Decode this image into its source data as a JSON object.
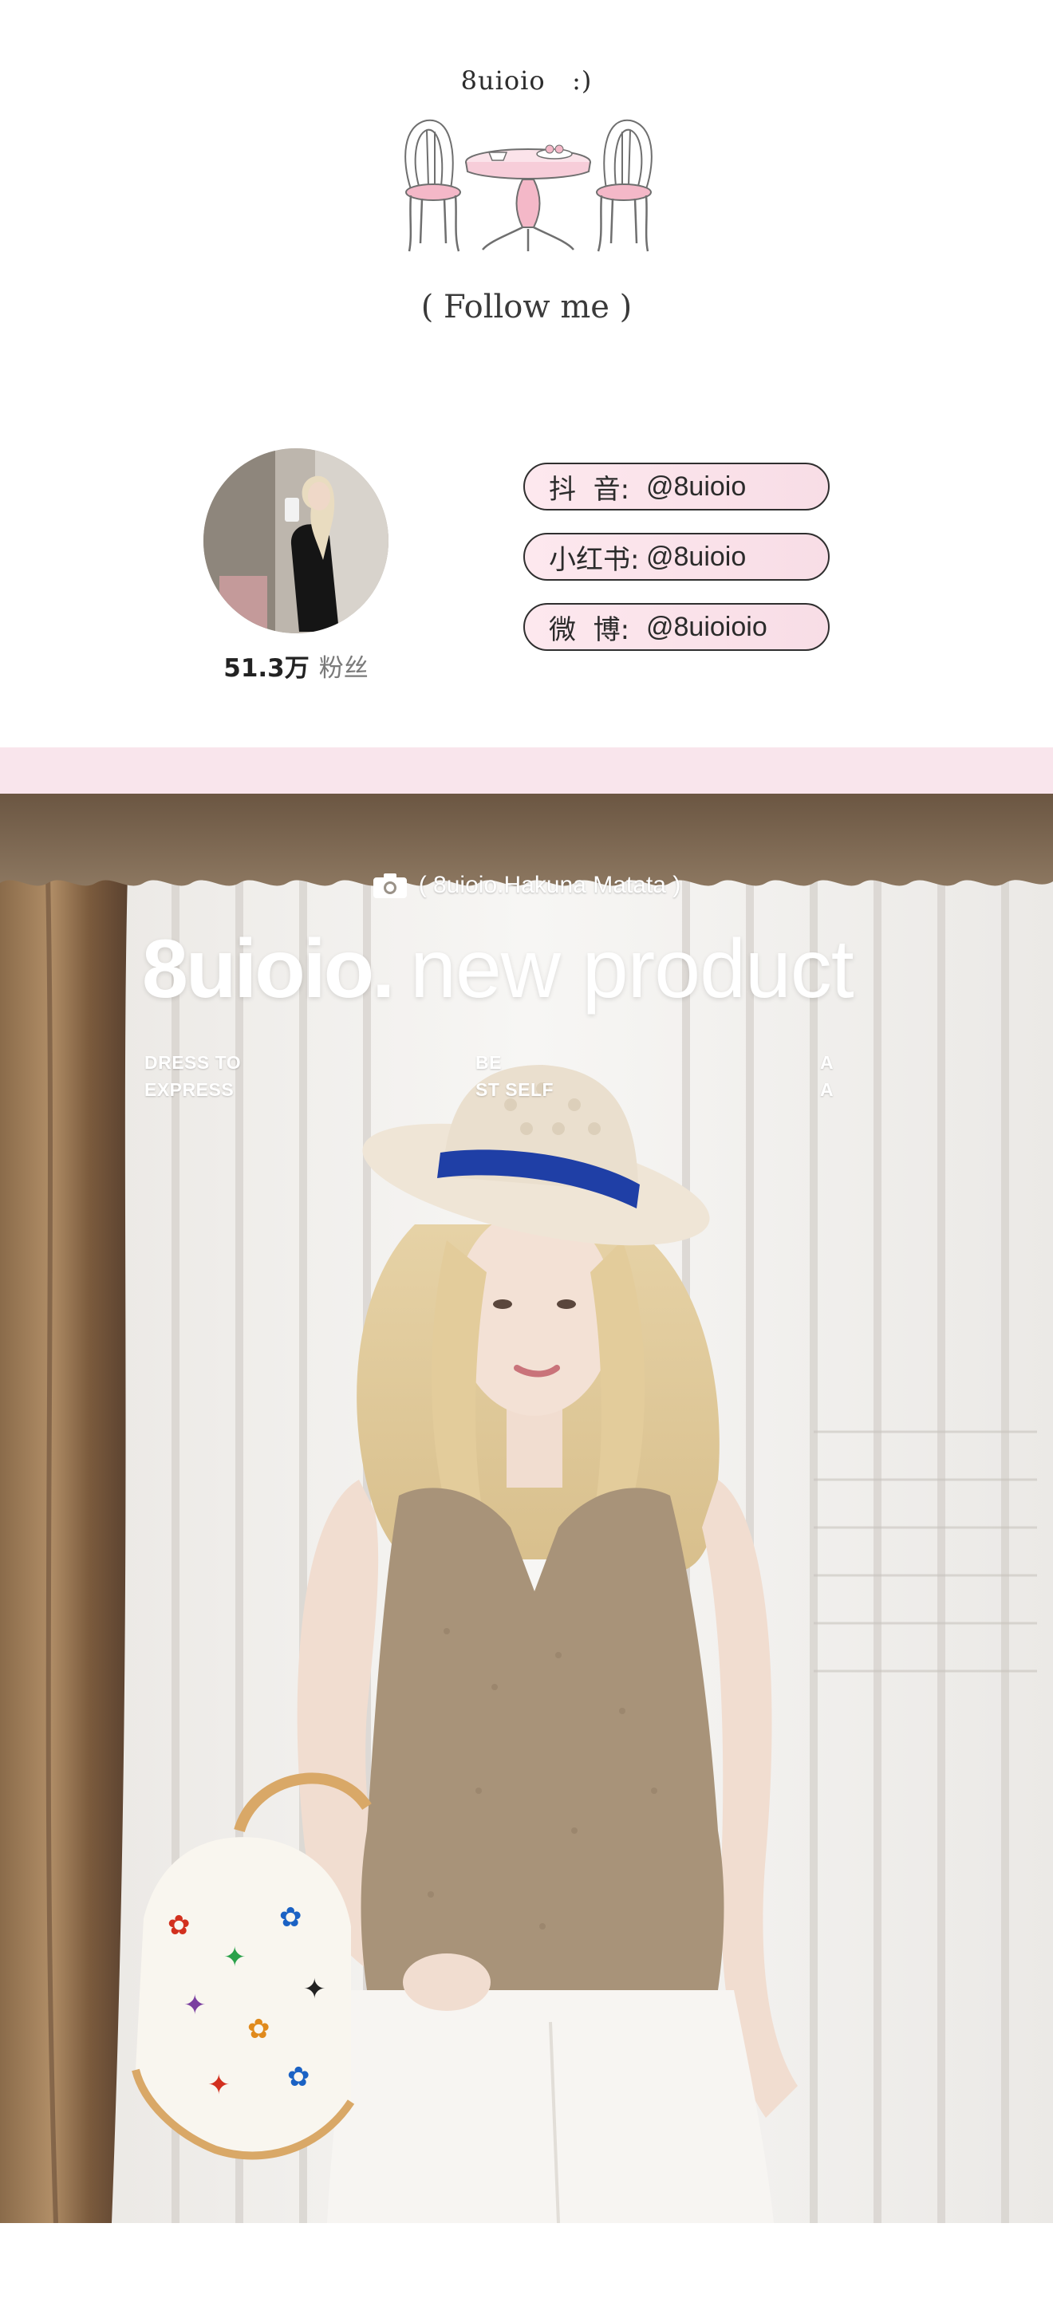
{
  "header": {
    "brand_name": "8uioio   :)",
    "follow_text": "( Follow me )"
  },
  "profile": {
    "follower_count": "51.3万",
    "follower_unit": "粉丝",
    "socials": [
      {
        "platform": "抖  音:",
        "handle": "@8uioio"
      },
      {
        "platform": "小红书:",
        "handle": "@8uioio"
      },
      {
        "platform": "微  博:",
        "handle": "@8uioioio"
      }
    ]
  },
  "hero": {
    "tag": "( 8uioio.Hakuna Matata )",
    "title_bold": "8uioio.",
    "title_light": "new product",
    "sub_left": "DRESS TO\nEXPRESS",
    "sub_mid": "BE\nST SELF",
    "sub_right": "A\nA"
  },
  "colors": {
    "pill_fill": "#fde8ee",
    "pink_band": "#f9e5ec",
    "hat_band": "#1f3fa6"
  },
  "icons": {
    "camera": "camera-icon"
  }
}
